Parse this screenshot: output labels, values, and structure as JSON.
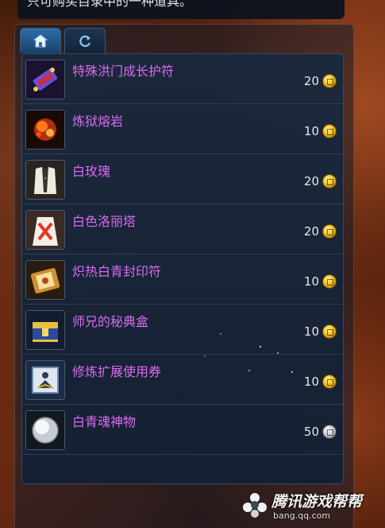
{
  "header": {
    "text": "只可购买目录中的一种道具。"
  },
  "tabs": [
    {
      "label": "",
      "icon": "shop-icon",
      "active": true
    },
    {
      "label": "",
      "icon": "refresh-icon",
      "active": false
    }
  ],
  "items": [
    {
      "name": "特殊洪门成长护符",
      "price": "20",
      "currency": "gold-coin-icon",
      "icon": "charm-icon"
    },
    {
      "name": "炼狱熔岩",
      "price": "10",
      "currency": "gold-coin-icon",
      "icon": "lava-icon"
    },
    {
      "name": "白玫瑰",
      "price": "20",
      "currency": "gold-coin-icon",
      "icon": "white-suit-icon"
    },
    {
      "name": "白色洛丽塔",
      "price": "20",
      "currency": "gold-coin-icon",
      "icon": "lolita-dress-icon"
    },
    {
      "name": "炽热白青封印符",
      "price": "10",
      "currency": "gold-coin-icon",
      "icon": "seal-charm-icon"
    },
    {
      "name": "师兄的秘典盒",
      "price": "10",
      "currency": "gold-coin-icon",
      "icon": "treasure-box-icon"
    },
    {
      "name": "修炼扩展使用券",
      "price": "10",
      "currency": "gold-coin-icon",
      "icon": "training-ticket-icon"
    },
    {
      "name": "白青魂神物",
      "price": "50",
      "currency": "silver-coin-icon",
      "icon": "soul-orb-icon"
    }
  ],
  "watermark": {
    "title": "腾讯游戏帮帮",
    "url": "bang.qq.com"
  },
  "colors": {
    "item_name": "#d86cf0",
    "price": "#e8e8e8",
    "panel_bg": "#1a283c"
  }
}
